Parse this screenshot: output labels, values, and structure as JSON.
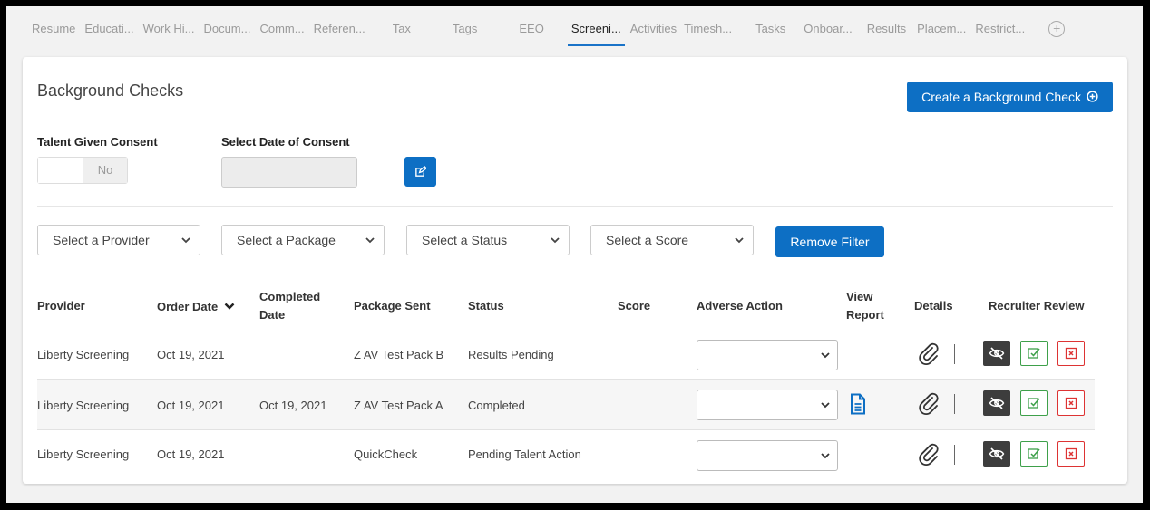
{
  "tabs": [
    {
      "label": "Resume",
      "active": false
    },
    {
      "label": "Educati...",
      "active": false
    },
    {
      "label": "Work Hi...",
      "active": false
    },
    {
      "label": "Docum...",
      "active": false
    },
    {
      "label": "Comm...",
      "active": false
    },
    {
      "label": "Referen...",
      "active": false
    },
    {
      "label": "Tax",
      "active": false
    },
    {
      "label": "Tags",
      "active": false
    },
    {
      "label": "EEO",
      "active": false
    },
    {
      "label": "Screeni...",
      "active": true
    },
    {
      "label": "Activities",
      "active": false
    },
    {
      "label": "Timesh...",
      "active": false
    },
    {
      "label": "Tasks",
      "active": false
    },
    {
      "label": "Onboar...",
      "active": false
    },
    {
      "label": "Results",
      "active": false
    },
    {
      "label": "Placem...",
      "active": false
    },
    {
      "label": "Restrict...",
      "active": false
    }
  ],
  "tab_add_symbol": "+",
  "page_title": "Background Checks",
  "create_button_label": "Create a Background Check",
  "consent": {
    "label": "Talent Given Consent",
    "toggle_state": "No"
  },
  "consent_date": {
    "label": "Select Date of Consent",
    "value": ""
  },
  "filters": {
    "provider_placeholder": "Select a Provider",
    "package_placeholder": "Select a Package",
    "status_placeholder": "Select a Status",
    "score_placeholder": "Select a Score",
    "remove_label": "Remove Filter"
  },
  "table": {
    "headers": {
      "provider": "Provider",
      "order_date": "Order Date",
      "completed_date_1": "Completed",
      "completed_date_2": "Date",
      "package_sent": "Package Sent",
      "status": "Status",
      "score": "Score",
      "adverse_action": "Adverse Action",
      "view_report_1": "View",
      "view_report_2": "Report",
      "details": "Details",
      "recruiter_review": "Recruiter Review"
    },
    "rows": [
      {
        "provider": "Liberty Screening",
        "order_date": "Oct 19, 2021",
        "completed_date": "",
        "package": "Z AV Test Pack B",
        "status": "Results Pending",
        "score": "",
        "has_report": false
      },
      {
        "provider": "Liberty Screening",
        "order_date": "Oct 19, 2021",
        "completed_date": "Oct 19, 2021",
        "package": "Z AV Test Pack A",
        "status": "Completed",
        "score": "",
        "has_report": true
      },
      {
        "provider": "Liberty Screening",
        "order_date": "Oct 19, 2021",
        "completed_date": "",
        "package": "QuickCheck",
        "status": "Pending Talent Action",
        "score": "",
        "has_report": false
      }
    ]
  },
  "colors": {
    "primary": "#0d6fc4",
    "approve": "#3ea04a",
    "reject": "#dd3333",
    "hide": "#3d3d3d"
  }
}
